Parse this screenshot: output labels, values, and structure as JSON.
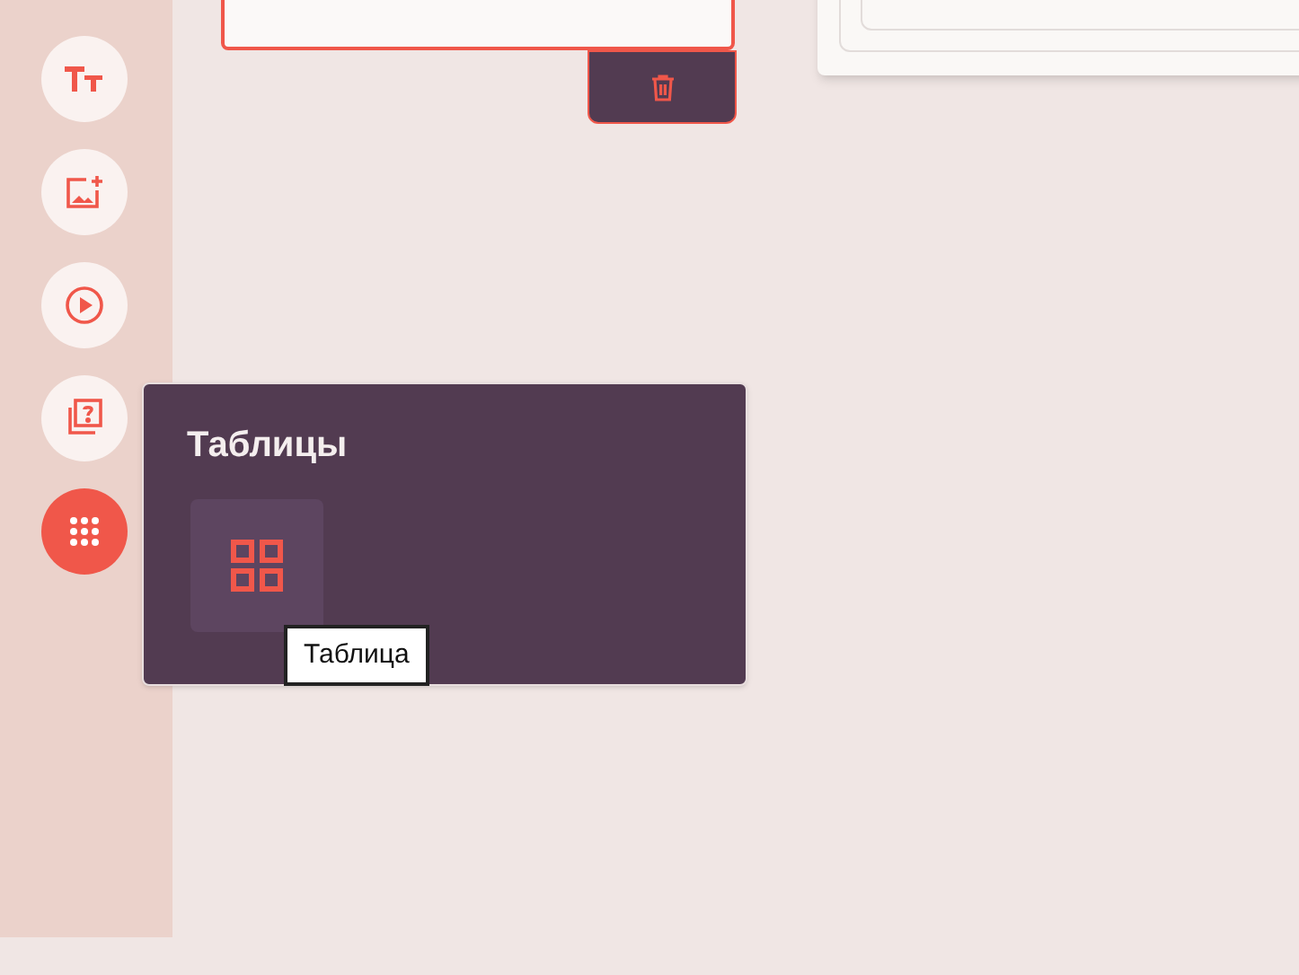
{
  "sidebar": {
    "items": [
      {
        "kind": "text",
        "selected": false
      },
      {
        "kind": "image",
        "selected": false
      },
      {
        "kind": "video",
        "selected": false
      },
      {
        "kind": "quiz",
        "selected": false
      },
      {
        "kind": "more",
        "selected": true
      }
    ]
  },
  "panel": {
    "title": "Таблицы",
    "items": [
      {
        "kind": "table",
        "tooltip": "Таблица"
      }
    ]
  }
}
